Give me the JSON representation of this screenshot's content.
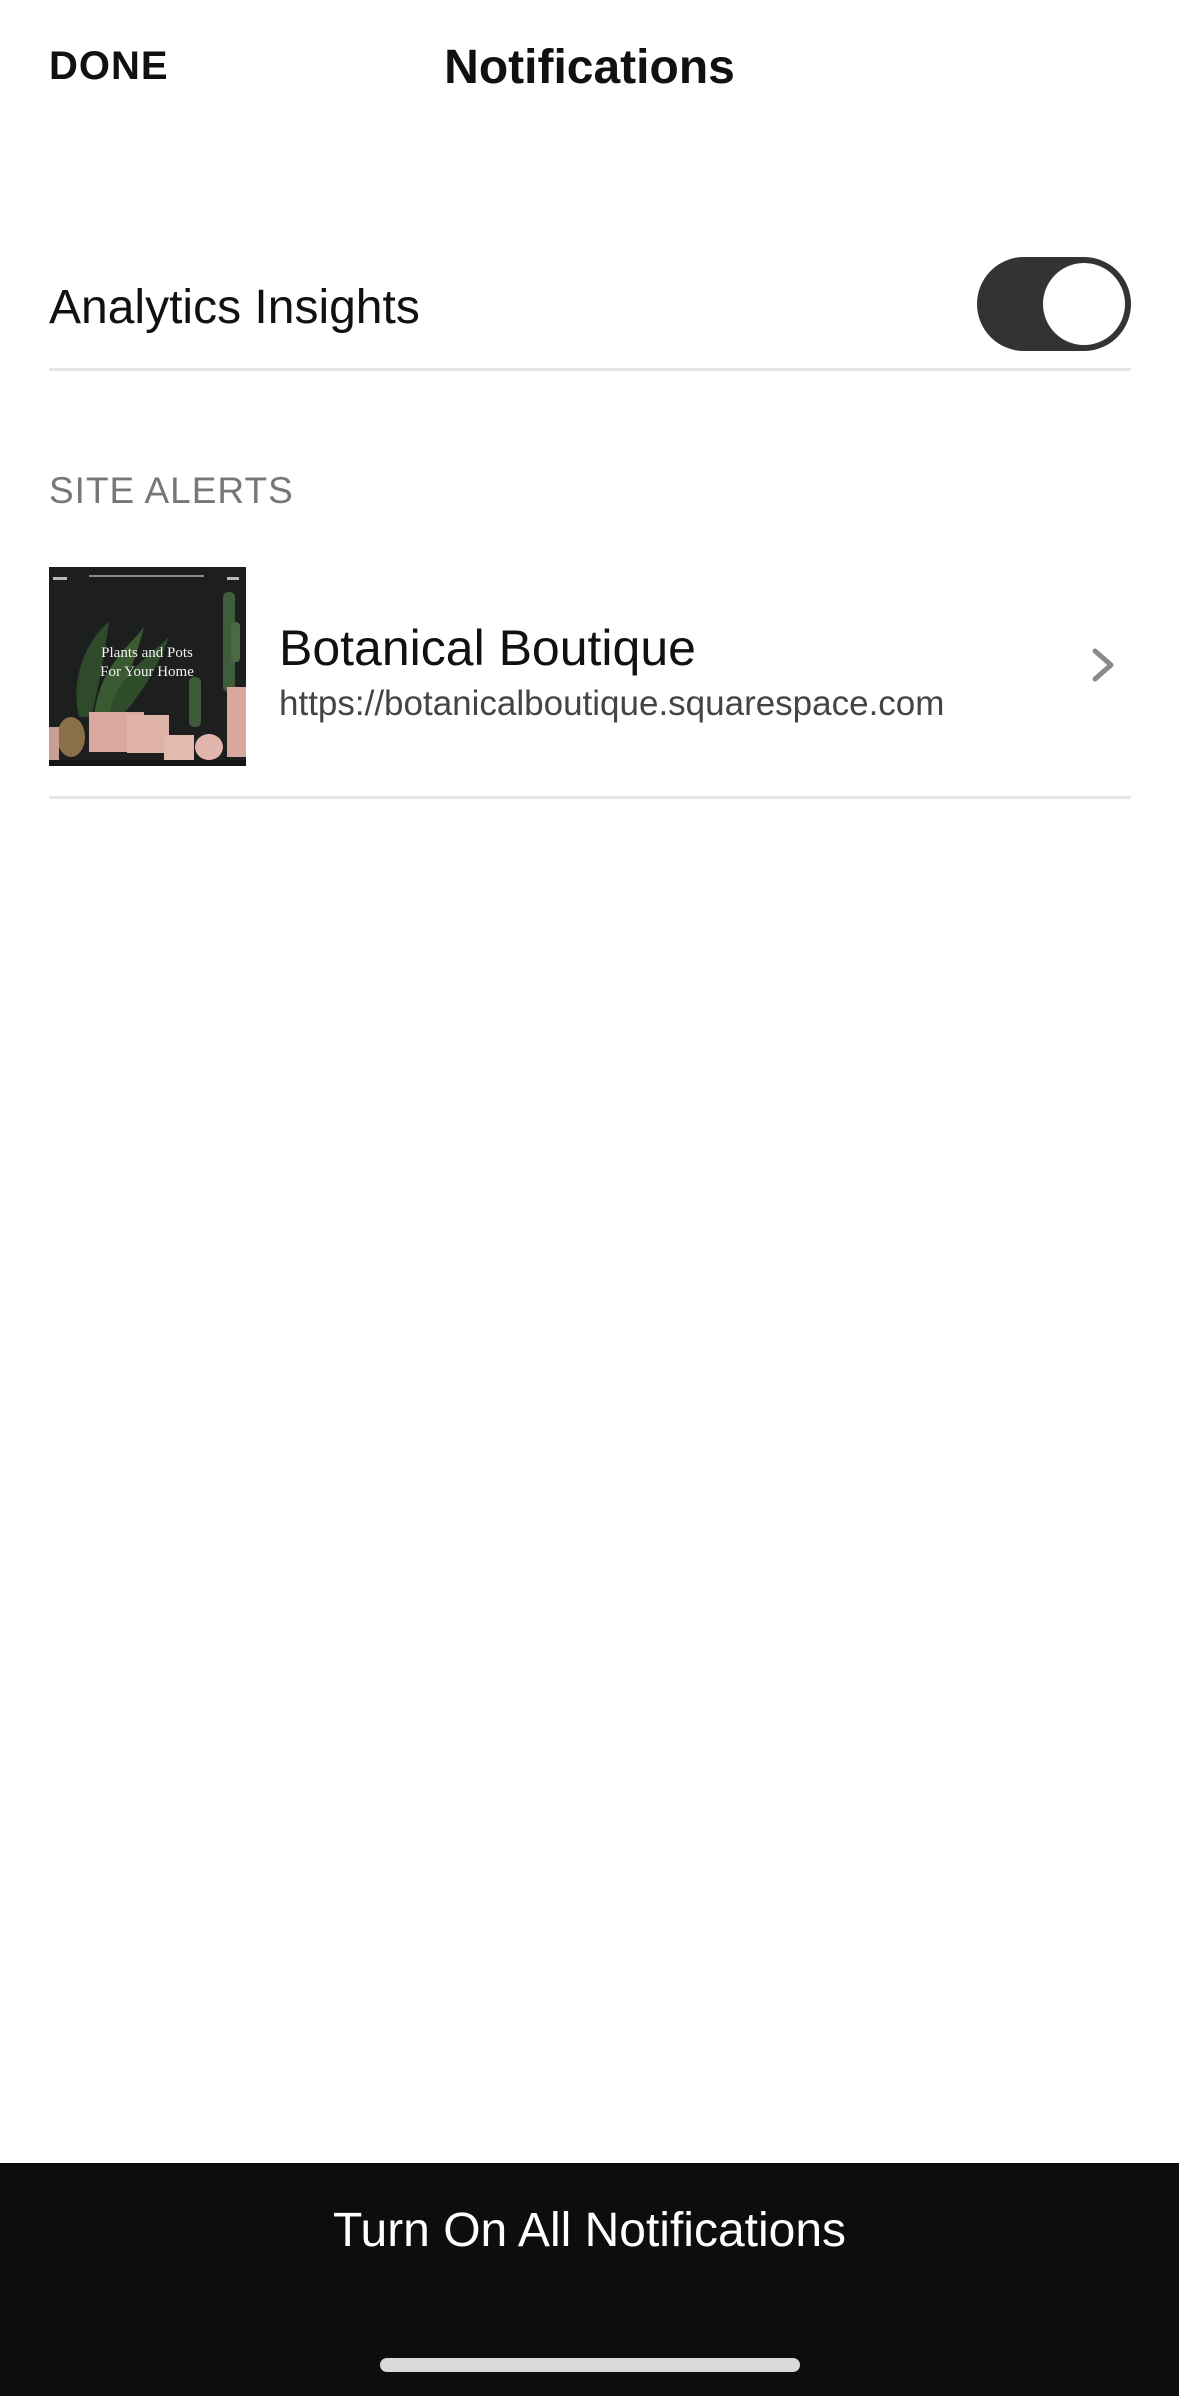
{
  "header": {
    "done_label": "DONE",
    "title": "Notifications"
  },
  "analytics": {
    "label": "Analytics Insights",
    "enabled": true
  },
  "site_alerts": {
    "section_title": "SITE ALERTS",
    "sites": [
      {
        "name": "Botanical Boutique",
        "url": "https://botanicalboutique.squarespace.com",
        "thumbnail": {
          "headline_line1": "Plants and Pots",
          "headline_line2": "For Your Home"
        }
      }
    ]
  },
  "footer": {
    "all_notifications_label": "Turn On All Notifications"
  },
  "icons": {
    "row_chevron": "chevron-right-icon",
    "thumbnail": "site-thumbnail-image"
  },
  "colors": {
    "toggle_on": "#333333",
    "bottom_bar": "#0d0d0d",
    "divider": "#e6e6e6",
    "section_title": "#777777"
  }
}
